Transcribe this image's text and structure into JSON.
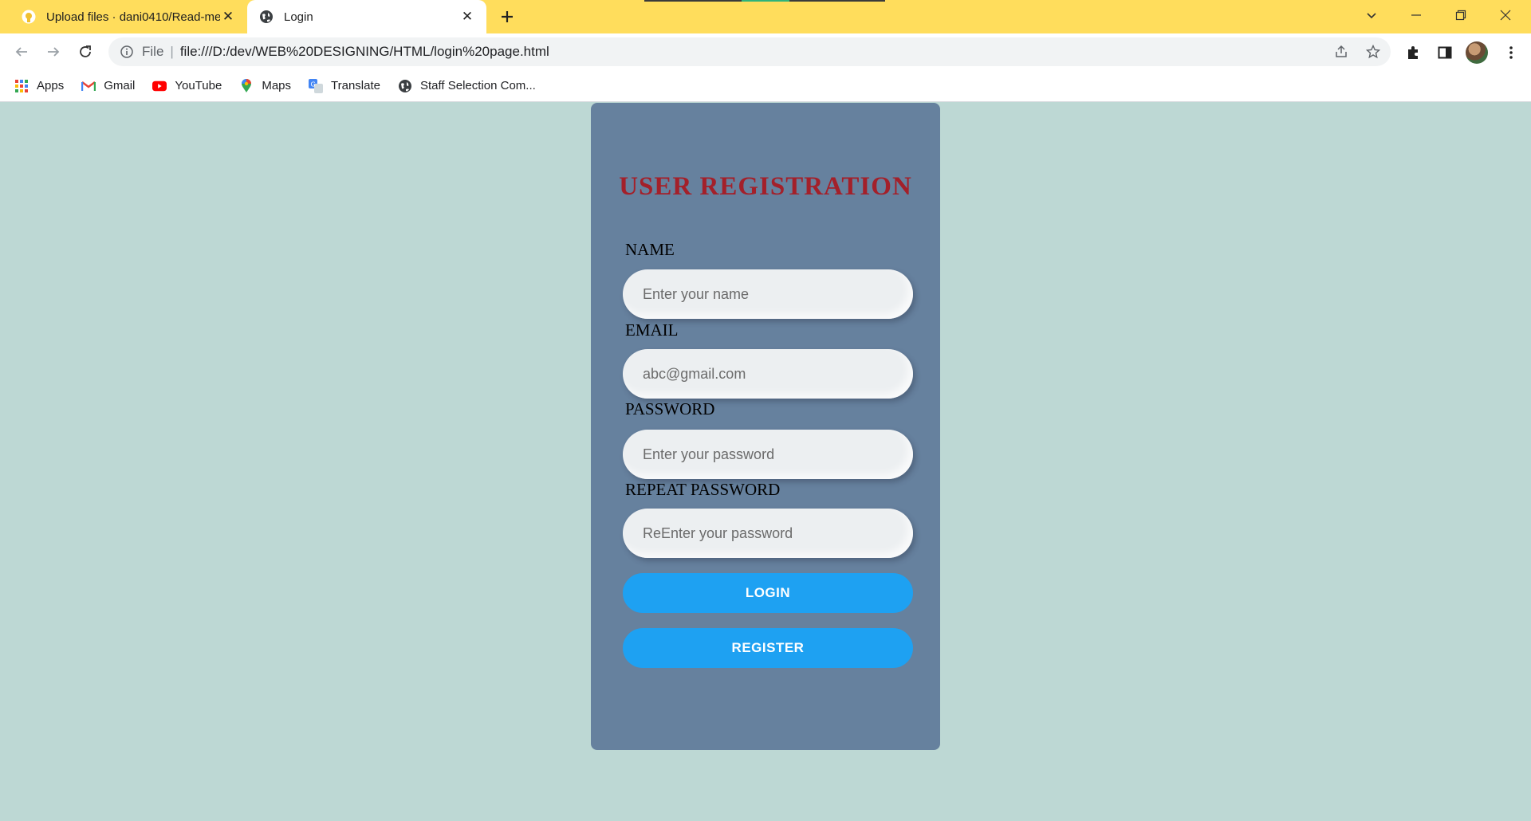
{
  "browser": {
    "tabs": [
      {
        "title": "Upload files · dani0410/Read-me",
        "icon": "github-icon",
        "active": false
      },
      {
        "title": "Login",
        "icon": "globe-icon",
        "active": true
      }
    ],
    "address_bar": {
      "scheme_label": "File",
      "url": "file:///D:/dev/WEB%20DESIGNING/HTML/login%20page.html"
    },
    "bookmarks": [
      {
        "label": "Apps",
        "icon": "apps-grid-icon"
      },
      {
        "label": "Gmail",
        "icon": "gmail-icon"
      },
      {
        "label": "YouTube",
        "icon": "youtube-icon"
      },
      {
        "label": "Maps",
        "icon": "maps-pin-icon"
      },
      {
        "label": "Translate",
        "icon": "translate-icon"
      },
      {
        "label": "Staff Selection Com...",
        "icon": "globe-icon"
      }
    ],
    "colors": {
      "tabstrip": "#ffdd5c",
      "page_bg": "#bdd8d4"
    }
  },
  "form": {
    "title": "USER REGISTRATION",
    "fields": [
      {
        "label": "NAME",
        "placeholder": "Enter your name",
        "type": "text"
      },
      {
        "label": "EMAIL",
        "placeholder": "abc@gmail.com",
        "type": "email"
      },
      {
        "label": "PASSWORD",
        "placeholder": "Enter your password",
        "type": "password"
      },
      {
        "label": "REPEAT PASSWORD",
        "placeholder": "ReEnter your password",
        "type": "password"
      }
    ],
    "buttons": {
      "login": "LOGIN",
      "register": "REGISTER"
    },
    "colors": {
      "card": "#66819e",
      "title": "#a3202a",
      "button": "#1ea1f2"
    }
  }
}
